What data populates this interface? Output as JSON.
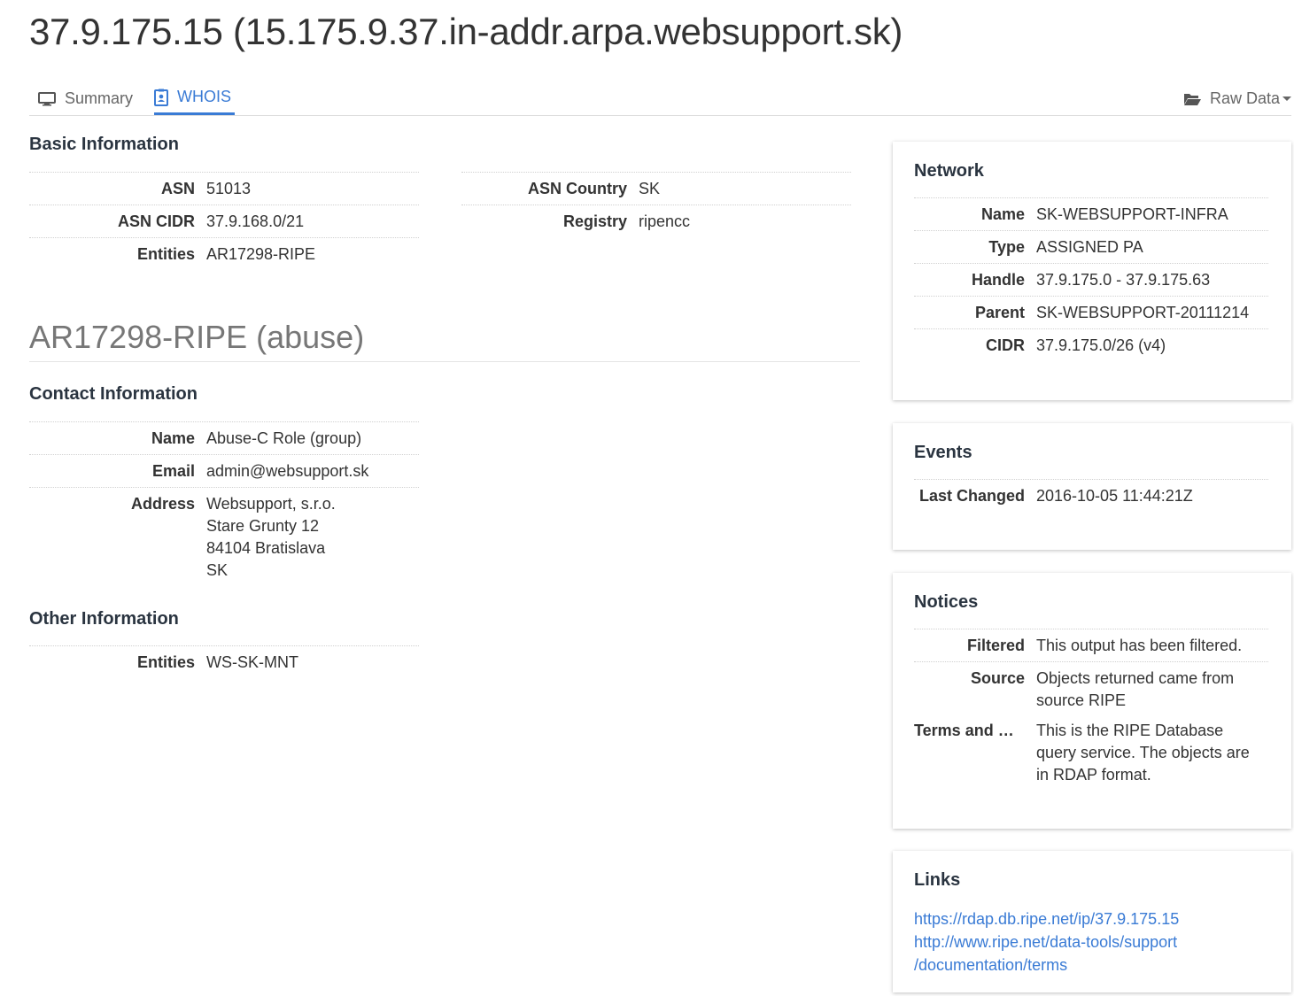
{
  "page_title": "37.9.175.15 (15.175.9.37.in-addr.arpa.websupport.sk)",
  "tabs": {
    "summary": {
      "label": "Summary",
      "icon": "monitor-icon"
    },
    "whois": {
      "label": "WHOIS",
      "icon": "contact-card-icon"
    },
    "raw": {
      "label": "Raw Data",
      "icon": "folder-open-icon"
    }
  },
  "basic": {
    "heading": "Basic Information",
    "asn_label": "ASN",
    "asn_value": "51013",
    "asn_country_label": "ASN Country",
    "asn_country_value": "SK",
    "asn_cidr_label": "ASN CIDR",
    "asn_cidr_value": "37.9.168.0/21",
    "registry_label": "Registry",
    "registry_value": "ripencc",
    "entities_label": "Entities",
    "entities_value": "AR17298-RIPE"
  },
  "entity": {
    "title": "AR17298-RIPE (abuse)",
    "contact_heading": "Contact Information",
    "name_label": "Name",
    "name_value": "Abuse-C Role (group)",
    "email_label": "Email",
    "email_value": "admin@websupport.sk",
    "address_label": "Address",
    "address_lines": [
      "Websupport, s.r.o.",
      "Stare Grunty 12",
      "84104 Bratislava",
      "SK"
    ],
    "other_heading": "Other Information",
    "other_entities_label": "Entities",
    "other_entities_value": "WS-SK-MNT"
  },
  "network": {
    "heading": "Network",
    "name_label": "Name",
    "name_value": "SK-WEBSUPPORT-INFRA",
    "type_label": "Type",
    "type_value": "ASSIGNED PA",
    "handle_label": "Handle",
    "handle_value": "37.9.175.0 - 37.9.175.63",
    "parent_label": "Parent",
    "parent_value": "SK-WEBSUPPORT-20111214",
    "cidr_label": "CIDR",
    "cidr_value": "37.9.175.0/26 (v4)"
  },
  "events": {
    "heading": "Events",
    "last_changed_label": "Last Changed",
    "last_changed_value": "2016-10-05 11:44:21Z"
  },
  "notices": {
    "heading": "Notices",
    "filtered_label": "Filtered",
    "filtered_value": "This output has been filtered.",
    "source_label": "Source",
    "source_value": "Objects returned came from source RIPE",
    "terms_label": "Terms and Co...",
    "terms_value": "This is the RIPE Database query service. The objects are in RDAP format."
  },
  "links": {
    "heading": "Links",
    "link1": "https://rdap.db.ripe.net/ip/37.9.175.15",
    "link2_line1": "http://www.ripe.net/data-tools/support",
    "link2_line2": "/documentation/terms"
  },
  "colors": {
    "accent": "#3a7bd5",
    "heading": "#2a3440",
    "text": "#333333",
    "muted": "#777777"
  }
}
